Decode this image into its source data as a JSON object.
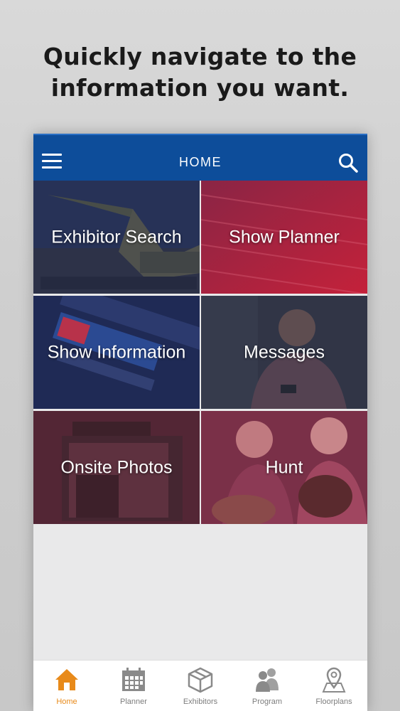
{
  "headline": {
    "line1": "Quickly navigate to the",
    "line2": "information you want."
  },
  "appbar": {
    "title": "HOME",
    "menu_icon": "hamburger-menu-icon",
    "search_icon": "search-icon",
    "color": "#0d4d9a"
  },
  "tiles": [
    {
      "label": "Exhibitor Search"
    },
    {
      "label": "Show Planner"
    },
    {
      "label": "Show Information"
    },
    {
      "label": "Messages"
    },
    {
      "label": "Onsite Photos"
    },
    {
      "label": "Hunt"
    }
  ],
  "tabbar": {
    "active_color": "#e88a1a",
    "inactive_color": "#7d7d7d",
    "items": [
      {
        "label": "Home",
        "icon": "house-icon",
        "active": true
      },
      {
        "label": "Planner",
        "icon": "calendar-icon",
        "active": false
      },
      {
        "label": "Exhibitors",
        "icon": "box-icon",
        "active": false
      },
      {
        "label": "Program",
        "icon": "people-icon",
        "active": false
      },
      {
        "label": "Floorplans",
        "icon": "map-pin-icon",
        "active": false
      }
    ]
  }
}
